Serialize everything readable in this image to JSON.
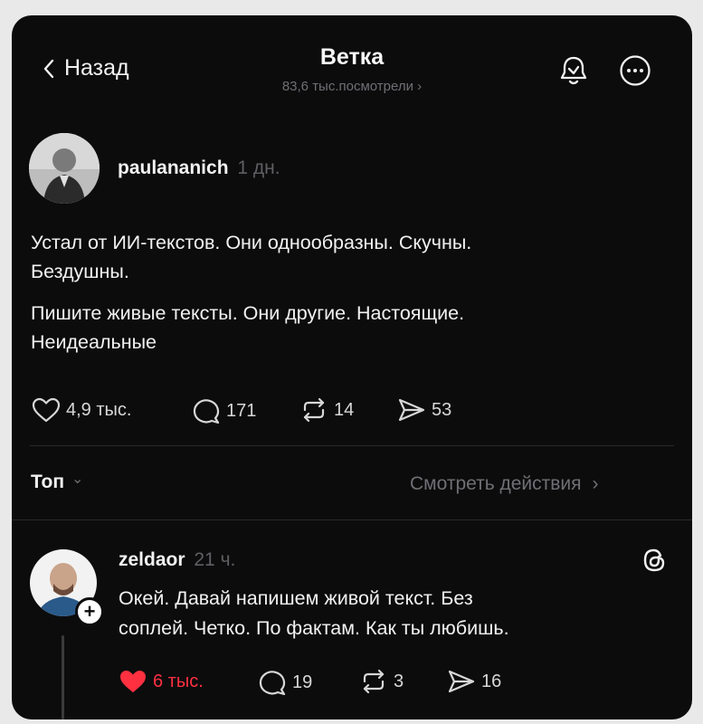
{
  "header": {
    "back_label": "Назад",
    "title": "Ветка",
    "views": "83,6 тыс.посмотрели",
    "views_chevron": "›"
  },
  "post": {
    "username": "paulananich",
    "time": "1 дн.",
    "line1": "Устал от ИИ-текстов. Они однообразны. Скучны.",
    "line2": "Бездушны.",
    "line3": "Пишите живые тексты. Они другие. Настоящие.",
    "line4": "Неидеальные",
    "likes": "4,9 тыс.",
    "comments": "171",
    "reposts": "14",
    "shares": "53"
  },
  "sort": {
    "label": "Топ",
    "chevron": "⌄",
    "view_activity": "Смотреть действия",
    "view_activity_chevron": "›"
  },
  "reply": {
    "username": "zeldaor",
    "time": "21 ч.",
    "line1": "Окей. Давай напишем живой текст. Без",
    "line2": "соплей. Четко. По фактам. Как ты любишь.",
    "likes": "6 тыс.",
    "comments": "19",
    "reposts": "3",
    "shares": "16"
  },
  "colors": {
    "background": "#0c0c0d",
    "text": "#f2f2f2",
    "muted": "#8e8e93",
    "like_active": "#ff3040"
  }
}
